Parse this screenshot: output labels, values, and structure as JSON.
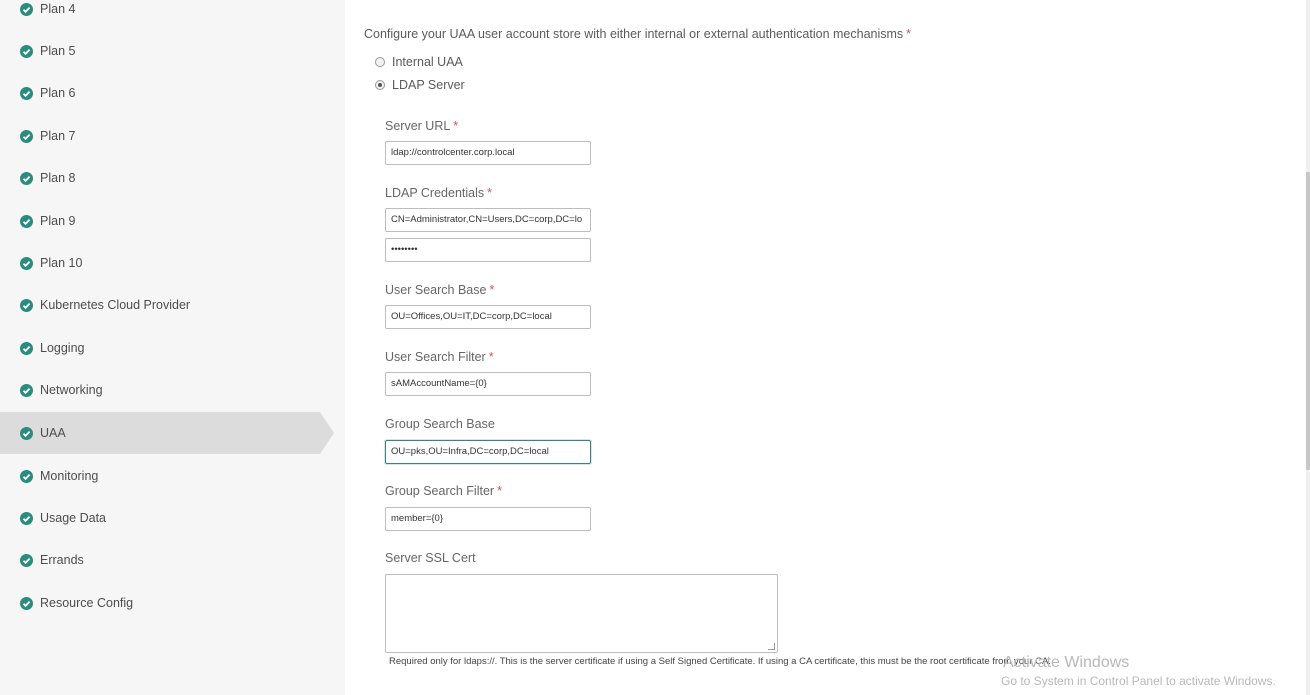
{
  "sidebar": {
    "items": [
      {
        "label": "Plan 4"
      },
      {
        "label": "Plan 5"
      },
      {
        "label": "Plan 6"
      },
      {
        "label": "Plan 7"
      },
      {
        "label": "Plan 8"
      },
      {
        "label": "Plan 9"
      },
      {
        "label": "Plan 10"
      },
      {
        "label": "Kubernetes Cloud Provider"
      },
      {
        "label": "Logging"
      },
      {
        "label": "Networking"
      },
      {
        "label": "UAA"
      },
      {
        "label": "Monitoring"
      },
      {
        "label": "Usage Data"
      },
      {
        "label": "Errands"
      },
      {
        "label": "Resource Config"
      }
    ],
    "active": "UAA",
    "check_color": "#2a8c7f"
  },
  "form": {
    "intro": "Configure your UAA user account store with either internal or external authentication mechanisms",
    "required_mark": "*",
    "auth_options": [
      {
        "label": "Internal UAA",
        "selected": false
      },
      {
        "label": "LDAP Server",
        "selected": true
      }
    ],
    "server_url": {
      "label": "Server URL",
      "value": "ldap://controlcenter.corp.local"
    },
    "ldap_credentials": {
      "label": "LDAP Credentials",
      "username": "CN=Administrator,CN=Users,DC=corp,DC=lo",
      "password": "••••••••"
    },
    "user_search_base": {
      "label": "User Search Base",
      "value": "OU=Offices,OU=IT,DC=corp,DC=local"
    },
    "user_search_filter": {
      "label": "User Search Filter",
      "value": "sAMAccountName={0}"
    },
    "group_search_base": {
      "label": "Group Search Base",
      "value": "OU=pks,OU=Infra,DC=corp,DC=local"
    },
    "group_search_filter": {
      "label": "Group Search Filter",
      "value": "member={0}"
    },
    "server_ssl_cert": {
      "label": "Server SSL Cert",
      "value": "",
      "hint": "Required only for ldaps://. This is the server certificate if using a Self Signed Certificate. If using a CA certificate, this must be the root certificate from your CA."
    }
  },
  "watermark": {
    "line1": "Activate Windows",
    "line2": "Go to System in Control Panel to activate Windows."
  }
}
